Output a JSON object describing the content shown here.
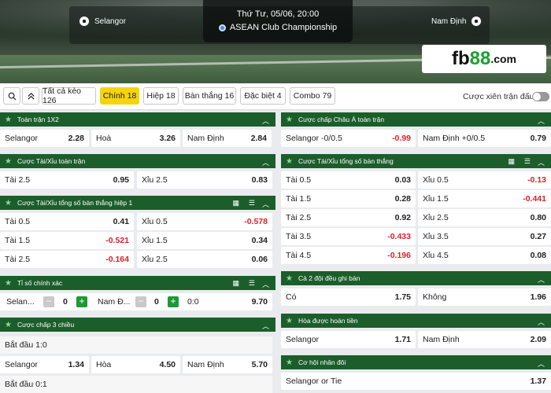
{
  "match": {
    "home": "Selangor",
    "away": "Nam Định",
    "datetime": "Thứ Tư, 05/06, 20:00",
    "league": "ASEAN Club Championship"
  },
  "brand": {
    "part1": "fb",
    "part2": "88",
    "part3": ".com"
  },
  "tabs": {
    "all": "Tất cả kèo 126",
    "main": "Chính 18",
    "half": "Hiệp 18",
    "goals": "Bàn thắng 16",
    "special": "Đặc biệt 4",
    "combo": "Combo 79",
    "toggle_label": "Cược xiên trận đấu"
  },
  "markets": {
    "m1x2": {
      "title": "Toàn trận 1X2",
      "home": "Selangor",
      "home_odds": "2.28",
      "draw": "Hoà",
      "draw_odds": "3.26",
      "away": "Nam Định",
      "away_odds": "2.84"
    },
    "ou_full": {
      "title": "Cược Tài/Xỉu toàn trận",
      "over": "Tài 2.5",
      "over_odds": "0.95",
      "under": "Xỉu 2.5",
      "under_odds": "0.83"
    },
    "ou_h1": {
      "title": "Cược Tài/Xỉu tổng số bàn thắng hiệp 1",
      "rows": [
        {
          "over": "Tài 0.5",
          "over_odds": "0.41",
          "under": "Xỉu 0.5",
          "under_odds": "-0.578"
        },
        {
          "over": "Tài 1.5",
          "over_odds": "-0.521",
          "under": "Xỉu 1.5",
          "under_odds": "0.34"
        },
        {
          "over": "Tài 2.5",
          "over_odds": "-0.164",
          "under": "Xỉu 2.5",
          "under_odds": "0.06"
        }
      ]
    },
    "exact": {
      "title": "Tỉ số chính xác",
      "home": "Selan...",
      "home_val": "0",
      "away": "Nam Đ...",
      "away_val": "0",
      "score": "0:0",
      "odds": "9.70"
    },
    "h3": {
      "title": "Cược chấp 3 chiều",
      "start1": "Bắt đầu 1:0",
      "home": "Selangor",
      "home_odds": "1.34",
      "draw": "Hòa",
      "draw_odds": "4.50",
      "away": "Nam Định",
      "away_odds": "5.70",
      "start2": "Bắt đầu 0:1"
    },
    "asian": {
      "title": "Cược chấp Châu Á toàn trận",
      "home": "Selangor -0/0.5",
      "home_odds": "-0.99",
      "away": "Nam Định +0/0.5",
      "away_odds": "0.79"
    },
    "ou_total": {
      "title": "Cược Tài/Xỉu tổng số bàn thắng",
      "rows": [
        {
          "over": "Tài 0.5",
          "over_odds": "0.03",
          "under": "Xỉu 0.5",
          "under_odds": "-0.13"
        },
        {
          "over": "Tài 1.5",
          "over_odds": "0.28",
          "under": "Xỉu 1.5",
          "under_odds": "-0.441"
        },
        {
          "over": "Tài 2.5",
          "over_odds": "0.92",
          "under": "Xỉu 2.5",
          "under_odds": "0.80"
        },
        {
          "over": "Tài 3.5",
          "over_odds": "-0.433",
          "under": "Xỉu 3.5",
          "under_odds": "0.27"
        },
        {
          "over": "Tài 4.5",
          "over_odds": "-0.196",
          "under": "Xỉu 4.5",
          "under_odds": "0.08"
        }
      ]
    },
    "btts": {
      "title": "Cả 2 đội đều ghi bàn",
      "yes": "Có",
      "yes_odds": "1.75",
      "no": "Không",
      "no_odds": "1.96"
    },
    "dnb": {
      "title": "Hòa được hoàn tiền",
      "home": "Selangor",
      "home_odds": "1.71",
      "away": "Nam Định",
      "away_odds": "2.09"
    },
    "dc": {
      "title": "Cơ hội nhân đôi",
      "home_tie": "Selangor or Tie",
      "home_tie_odds": "1.37"
    }
  }
}
